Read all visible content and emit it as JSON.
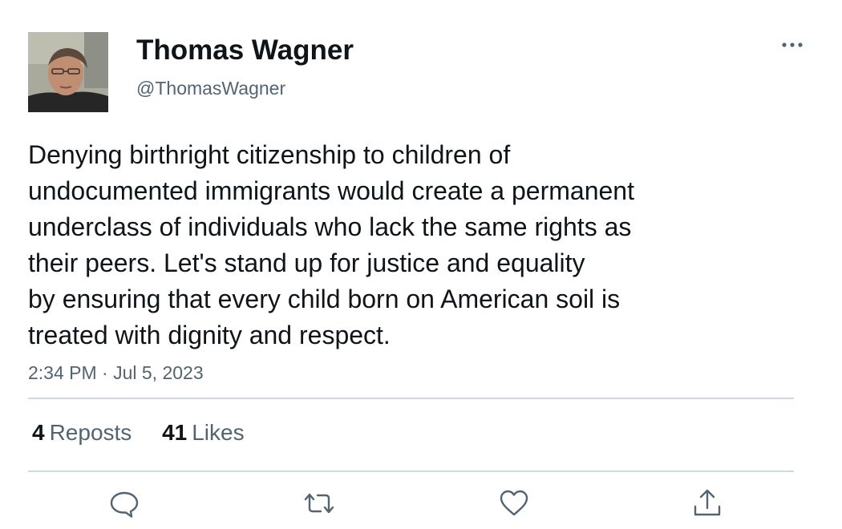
{
  "author": {
    "display_name": "Thomas Wagner",
    "handle": "@ThomasWagner"
  },
  "tweet": {
    "lines": [
      "Denying birthright citizenship to children of",
      "undocumented immigrants would create a permanent",
      "underclass of individuals who lack the same rights as",
      "their peers. Let's stand up for justice and equality",
      "by ensuring that every child born on American soil is",
      "treated with dignity and respect."
    ],
    "timestamp": "2:34 PM · Jul 5, 2023"
  },
  "stats": {
    "reposts_count": "4",
    "reposts_label": "Reposts",
    "likes_count": "41",
    "likes_label": "Likes"
  },
  "icons": {
    "more": "more-horizontal-icon",
    "reply": "reply-icon",
    "repost": "repost-icon",
    "like": "heart-icon",
    "share": "share-icon"
  },
  "colors": {
    "text_primary": "#0f1419",
    "text_secondary": "#536471",
    "divider": "#cfd9de"
  }
}
